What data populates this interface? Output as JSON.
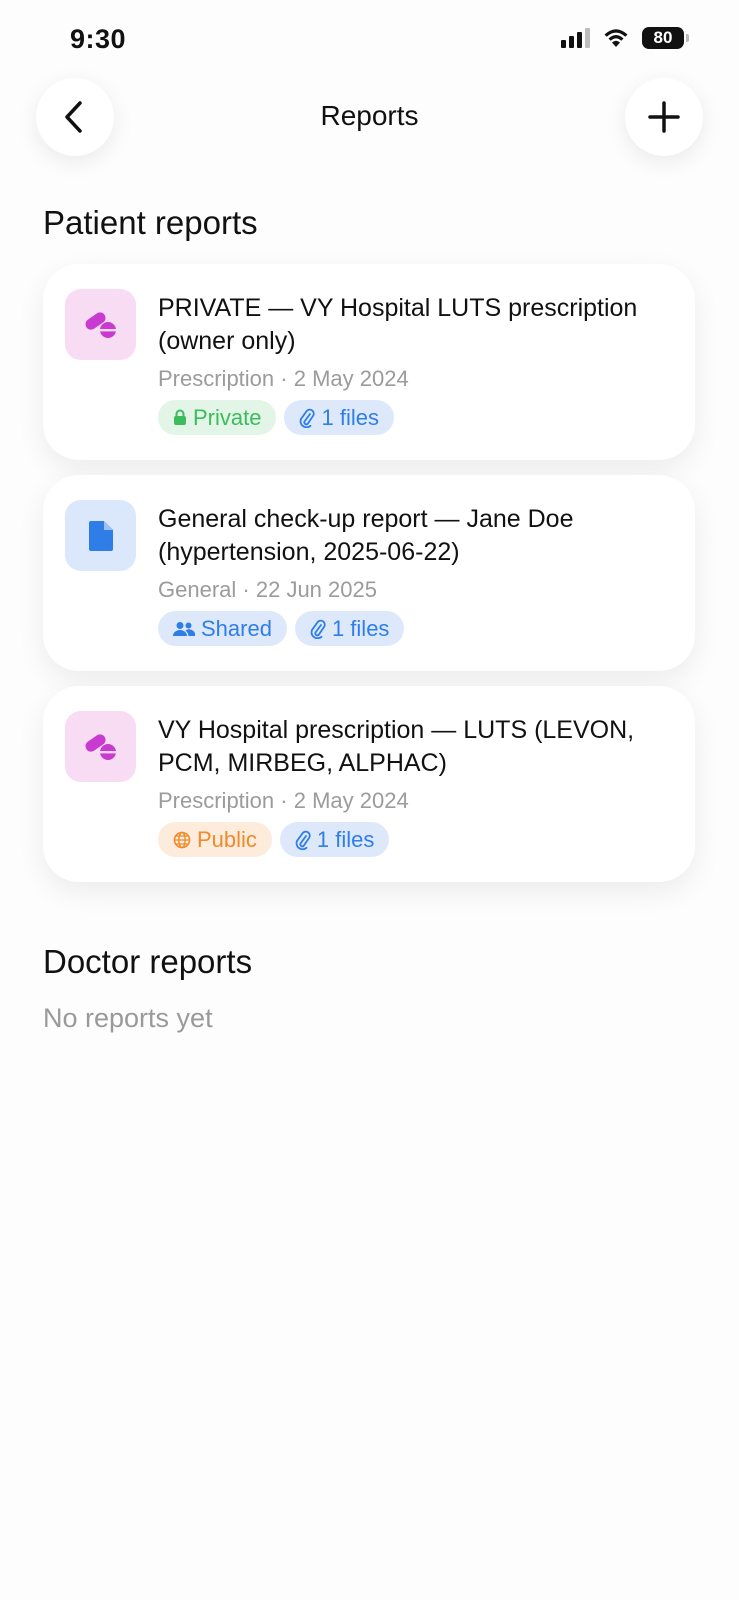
{
  "status_bar": {
    "time": "9:30",
    "battery": "80",
    "icons": [
      "signal-icon",
      "wifi-icon",
      "battery-icon"
    ]
  },
  "nav": {
    "title": "Reports",
    "back_icon": "chevron-left-icon",
    "add_icon": "plus-icon"
  },
  "patient_section": {
    "title": "Patient reports",
    "reports": [
      {
        "icon": "pill-icon",
        "icon_color": "#c93bd0",
        "title": "PRIVATE — VY Hospital LUTS prescription (owner only)",
        "type": "Prescription",
        "separator": "·",
        "date": "2 May 2024",
        "visibility": "Private",
        "visibility_icon": "lock-icon",
        "files": "1 files"
      },
      {
        "icon": "document-icon",
        "icon_color": "#2f7ee8",
        "title": "General check-up report — Jane Doe (hypertension, 2025-06-22)",
        "type": "General",
        "separator": "·",
        "date": "22 Jun 2025",
        "visibility": "Shared",
        "visibility_icon": "people-icon",
        "files": "1 files"
      },
      {
        "icon": "pill-icon",
        "icon_color": "#c93bd0",
        "title": "VY Hospital prescription — LUTS (LEVON, PCM, MIRBEG, ALPHAC)",
        "type": "Prescription",
        "separator": "·",
        "date": "2 May 2024",
        "visibility": "Public",
        "visibility_icon": "globe-icon",
        "files": "1 files"
      }
    ]
  },
  "doctor_section": {
    "title": "Doctor reports",
    "empty_text": "No reports yet"
  },
  "colors": {
    "private": "#3cbc5d",
    "shared": "#2f7ee8",
    "public": "#ef8a2d"
  }
}
